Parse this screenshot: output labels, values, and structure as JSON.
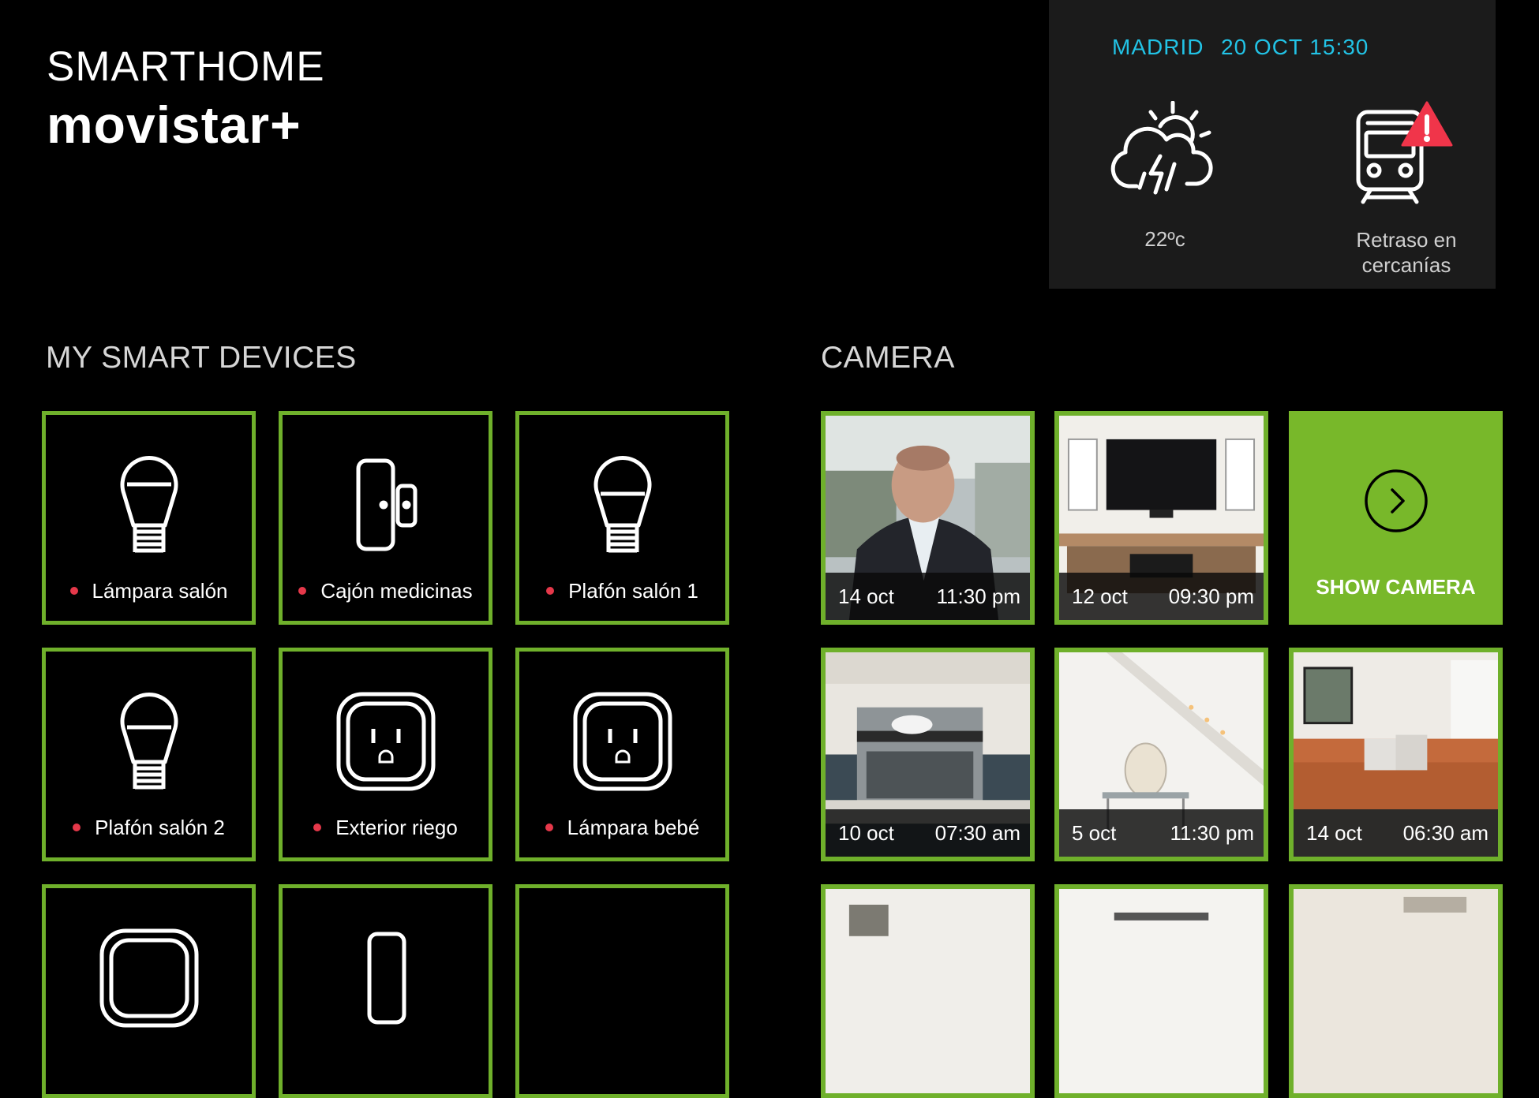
{
  "brand": {
    "top": "SMARTHOME",
    "logo": "movistar+"
  },
  "info": {
    "city": "MADRID",
    "datetime": "20 OCT 15:30",
    "weather_icon": "storm-cloud-icon",
    "temperature": "22ºc",
    "transit_icon": "train-alert-icon",
    "transit_line1": "Retraso en",
    "transit_line2": "cercanías"
  },
  "sections": {
    "devices_title": "MY SMART DEVICES",
    "camera_title": "CAMERA"
  },
  "devices": [
    {
      "label": "Lámpara salón",
      "icon": "bulb-icon",
      "status": "off"
    },
    {
      "label": "Cajón medicinas",
      "icon": "door-sensor-icon",
      "status": "off"
    },
    {
      "label": "Plafón salón 1",
      "icon": "bulb-icon",
      "status": "off"
    },
    {
      "label": "Plafón salón 2",
      "icon": "bulb-icon",
      "status": "off"
    },
    {
      "label": "Exterior riego",
      "icon": "plug-icon",
      "status": "off"
    },
    {
      "label": "Lámpara bebé",
      "icon": "plug-icon",
      "status": "off"
    }
  ],
  "camera": {
    "show_label": "SHOW CAMERA",
    "captures": [
      {
        "date": "14 oct",
        "time": "11:30 pm"
      },
      {
        "date": "12 oct",
        "time": "09:30 pm"
      },
      {
        "date": "10 oct",
        "time": "07:30 am"
      },
      {
        "date": "5 oct",
        "time": "11:30 pm"
      },
      {
        "date": "14 oct",
        "time": "06:30 am"
      }
    ]
  },
  "colors": {
    "accent": "#78b82a",
    "border": "#6fb02b",
    "status_dot": "#e5384a",
    "info_text": "#22c3e6",
    "alert": "#f0354a"
  }
}
